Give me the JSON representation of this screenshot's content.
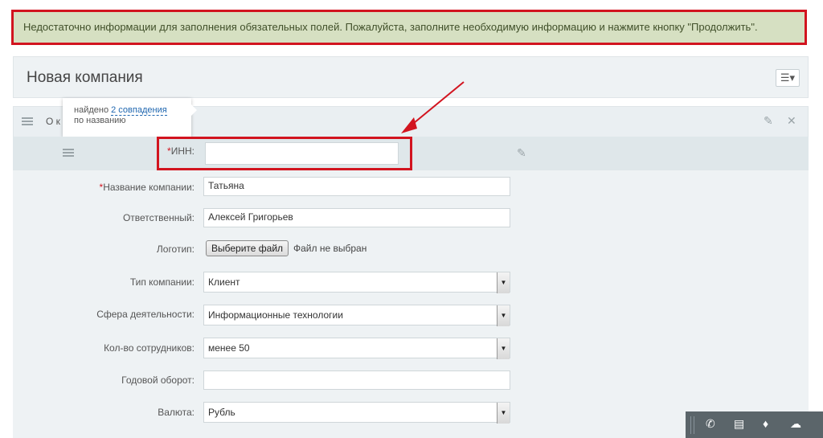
{
  "alert": {
    "message": "Недостаточно информации для заполнения обязательных полей. Пожалуйста, заполните необходимую информацию и нажмите кнопку \"Продолжить\"."
  },
  "header": {
    "title": "Новая компания",
    "menu_icon": "menu-icon"
  },
  "section": {
    "title": "О к"
  },
  "tooltip": {
    "prefix": "найдено ",
    "link": "2 совпадения",
    "suffix": "по названию"
  },
  "form": {
    "inn_label": "ИНН:",
    "company_name_label": "Название компании:",
    "company_name_value": "Татьяна",
    "responsible_label": "Ответственный:",
    "responsible_value": "Алексей Григорьев",
    "logo_label": "Логотип:",
    "logo_button": "Выберите файл",
    "logo_status": "Файл не выбран",
    "company_type_label": "Тип компании:",
    "company_type_value": "Клиент",
    "industry_label": "Сфера деятельности:",
    "industry_value": "Информационные технологии",
    "employees_label": "Кол-во сотрудников:",
    "employees_value": "менее 50",
    "revenue_label": "Годовой оборот:",
    "revenue_value": "",
    "currency_label": "Валюта:",
    "currency_value": "Рубль",
    "required_mark": "*"
  },
  "colors": {
    "alert_bg": "#d6e0c2",
    "highlight_red": "#d2141f",
    "link_blue": "#2067b0"
  }
}
